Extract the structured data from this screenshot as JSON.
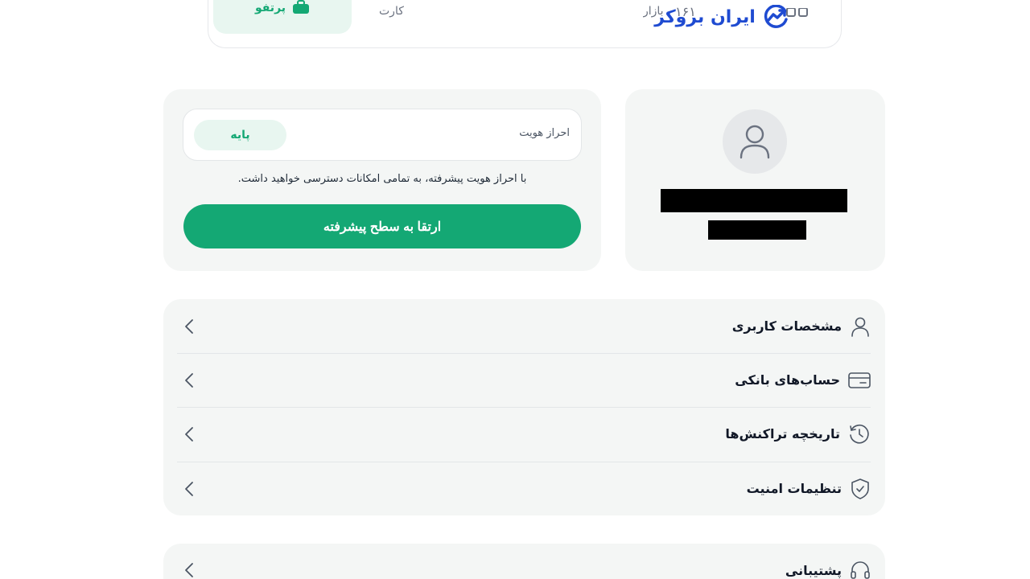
{
  "nav": {
    "active_label": "پرتفو",
    "item_a": "کارت",
    "item_b": "بازار",
    "item_c": "۱۶۱",
    "logo_text": "ایران بروکر"
  },
  "profile": {
    "avatar_icon": "user-icon"
  },
  "verification": {
    "label": "احراز هویت",
    "level": "پایه",
    "note": "با احراز هویت پیشرفته، به تمامی امکانات دسترسی خواهید داشت.",
    "upgrade_button": "ارتقا به سطح پیشرفته"
  },
  "menu": {
    "items": [
      {
        "label": "مشخصات کاربری",
        "icon": "user-icon"
      },
      {
        "label": "حساب‌های بانکی",
        "icon": "card-icon"
      },
      {
        "label": "تاریخچه تراکنش‌ها",
        "icon": "history-icon"
      },
      {
        "label": "تنظیمات امنیت",
        "icon": "shield-icon"
      }
    ]
  },
  "support": {
    "label": "پشتیبانی",
    "icon": "headset-icon"
  },
  "colors": {
    "accent": "#14a874",
    "accent_light": "#e8f6f0",
    "brand_blue": "#1f4bd1",
    "card_bg": "#f4f6f5"
  }
}
